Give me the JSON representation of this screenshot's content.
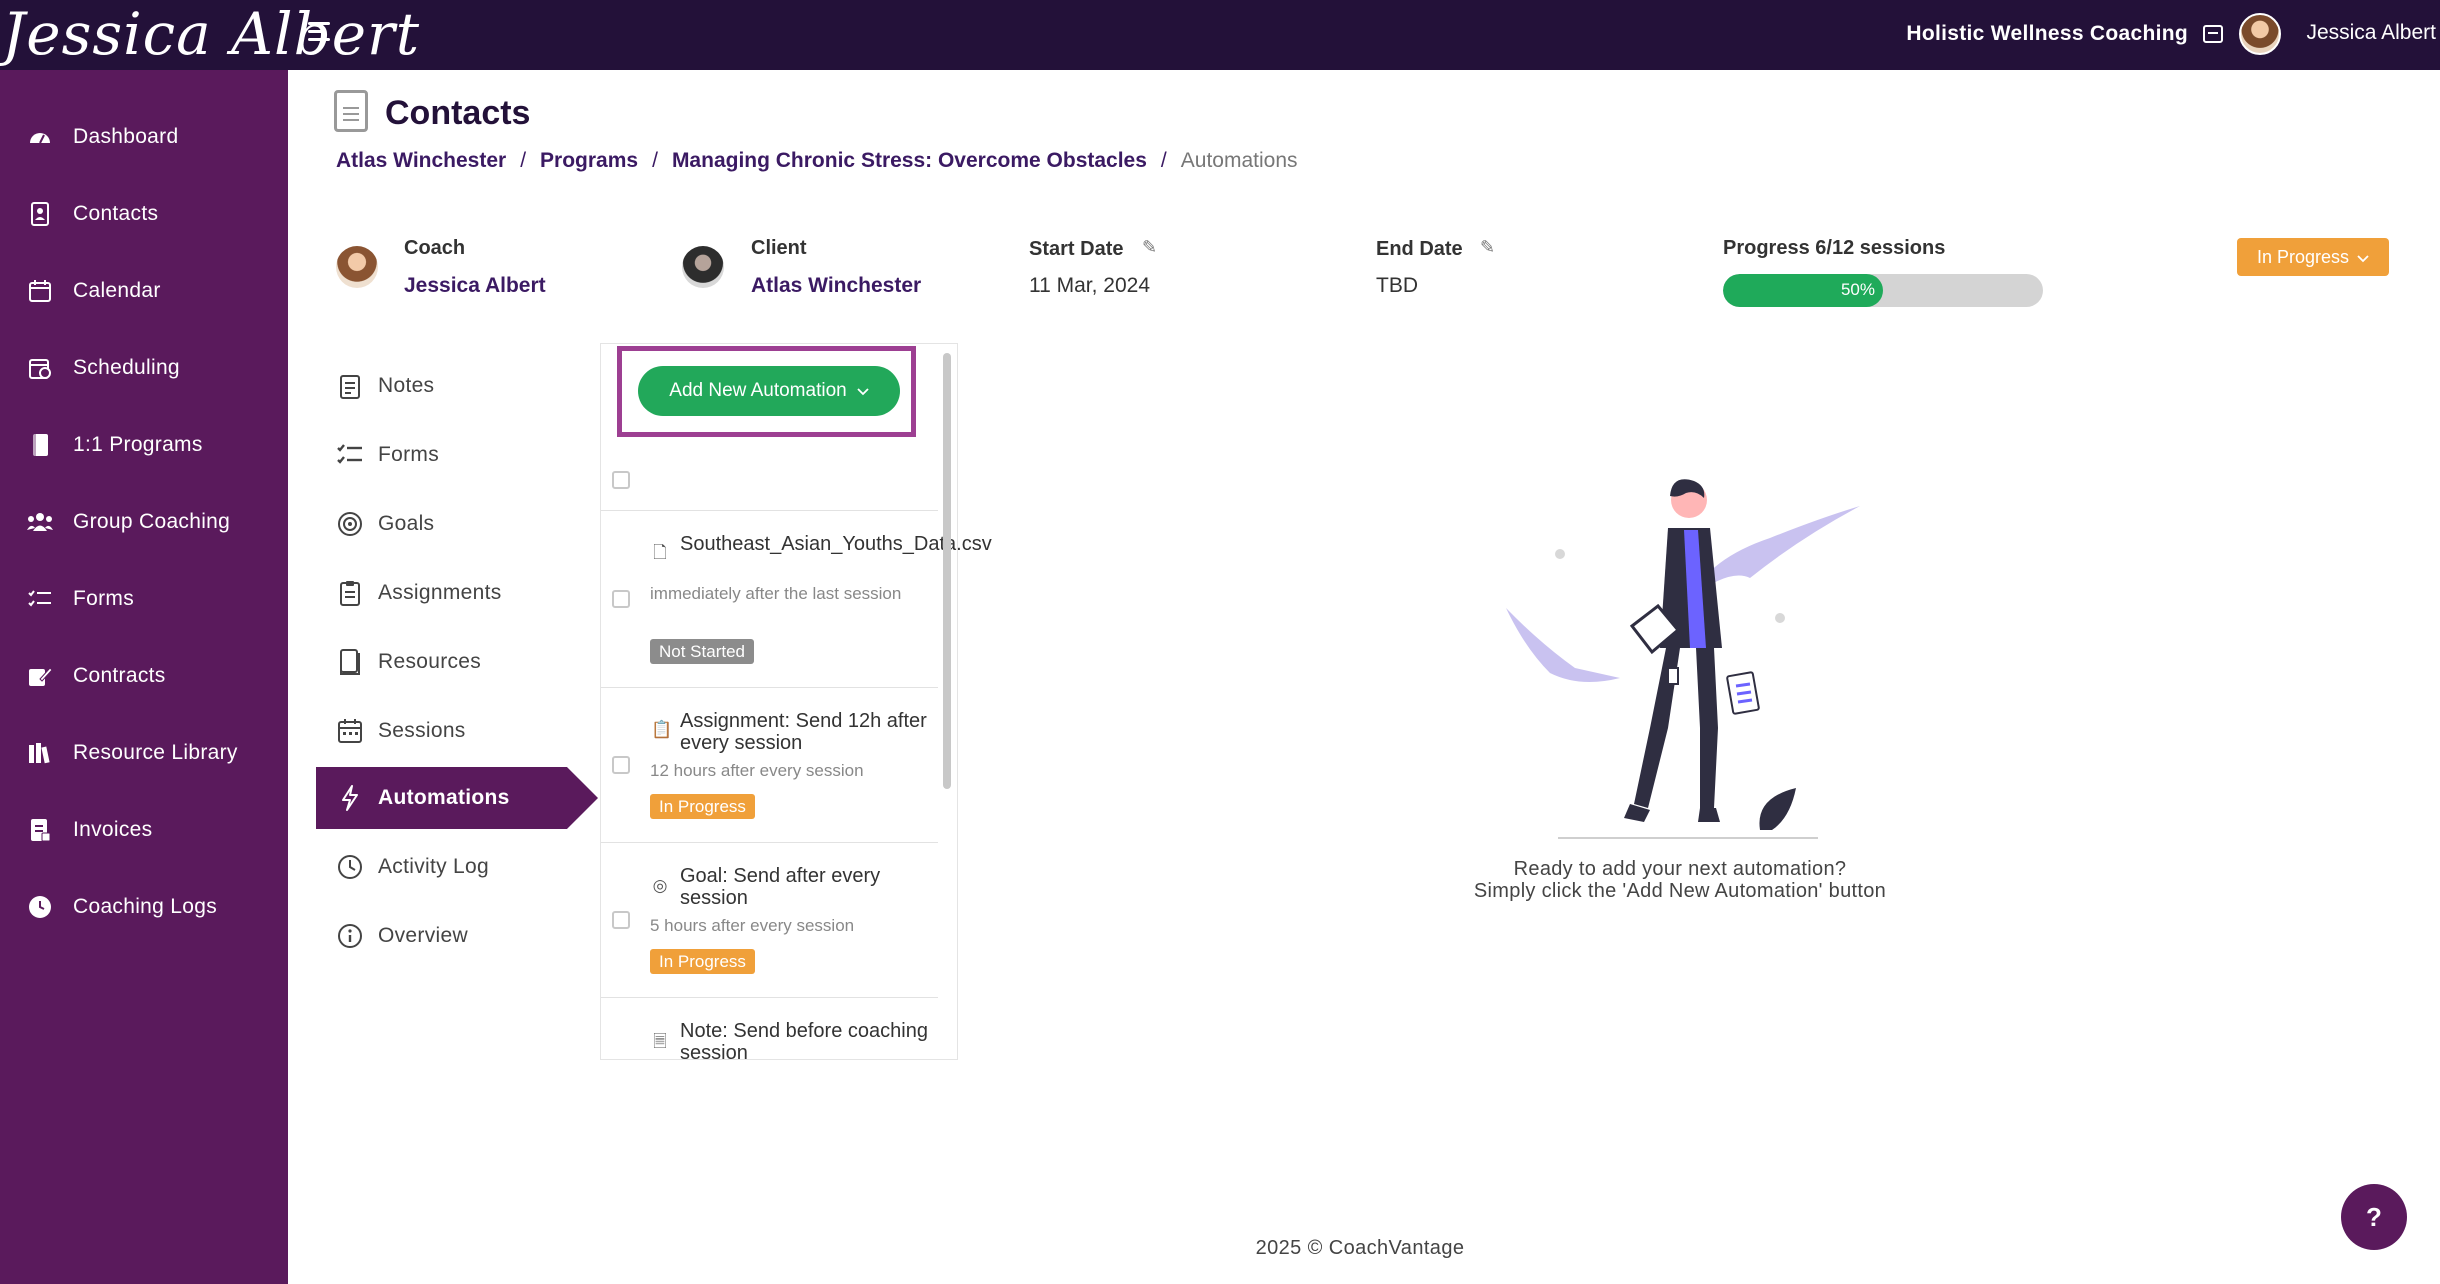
{
  "topbar": {
    "logo_text": "Jessica Albert",
    "org_name": "Holistic Wellness Coaching",
    "user_name": "Jessica Albert"
  },
  "sidebar": {
    "items": [
      {
        "label": "Dashboard",
        "icon": "dashboard-gauge-icon"
      },
      {
        "label": "Contacts",
        "icon": "contacts-book-icon"
      },
      {
        "label": "Calendar",
        "icon": "calendar-icon"
      },
      {
        "label": "Scheduling",
        "icon": "scheduling-calendar-icon"
      },
      {
        "label": "1:1 Programs",
        "icon": "book-icon"
      },
      {
        "label": "Group Coaching",
        "icon": "group-users-icon"
      },
      {
        "label": "Forms",
        "icon": "checklist-icon"
      },
      {
        "label": "Contracts",
        "icon": "signature-pen-icon"
      },
      {
        "label": "Resource Library",
        "icon": "library-icon"
      },
      {
        "label": "Invoices",
        "icon": "invoice-icon"
      },
      {
        "label": "Coaching Logs",
        "icon": "clock-icon"
      }
    ]
  },
  "page": {
    "title": "Contacts",
    "breadcrumb": {
      "contact": "Atlas Winchester",
      "programs": "Programs",
      "program": "Managing Chronic Stress: Overcome Obstacles",
      "current": "Automations",
      "sep": "/"
    }
  },
  "info": {
    "coach_label": "Coach",
    "coach_name": "Jessica Albert",
    "client_label": "Client",
    "client_name": "Atlas Winchester",
    "start_label": "Start Date",
    "start_value": "11 Mar, 2024",
    "end_label": "End Date",
    "end_value": "TBD",
    "progress_label": "Progress 6/12 sessions",
    "progress_percent": 50,
    "progress_text": "50%",
    "status": "In Progress"
  },
  "subnav": {
    "items": [
      {
        "label": "Notes",
        "icon": "notes-icon"
      },
      {
        "label": "Forms",
        "icon": "checklist-icon"
      },
      {
        "label": "Goals",
        "icon": "target-icon"
      },
      {
        "label": "Assignments",
        "icon": "clipboard-icon"
      },
      {
        "label": "Resources",
        "icon": "resources-book-icon"
      },
      {
        "label": "Sessions",
        "icon": "calendar-icon"
      },
      {
        "label": "Automations",
        "icon": "lightning-bolt-icon",
        "active": true
      },
      {
        "label": "Activity Log",
        "icon": "history-clock-icon"
      },
      {
        "label": "Overview",
        "icon": "info-circle-icon"
      }
    ]
  },
  "automations": {
    "add_button": "Add New Automation",
    "items": [
      {
        "title": "Southeast_Asian_Youths_Data.csv",
        "subtitle": "immediately after the last session",
        "status": "Not Started",
        "icon": "file-icon"
      },
      {
        "title": "Assignment: Send 12h after every session",
        "subtitle": "12 hours after every session",
        "status": "In Progress",
        "icon": "clipboard-icon"
      },
      {
        "title": "Goal: Send after every session",
        "subtitle": "5 hours after every session",
        "status": "In Progress",
        "icon": "target-icon"
      },
      {
        "title": "Note: Send before coaching session",
        "subtitle": "",
        "status": "",
        "icon": "notes-icon"
      }
    ]
  },
  "empty_state": {
    "line1": "Ready to add your next automation?",
    "line2": "Simply click the 'Add New Automation' button"
  },
  "footer": {
    "text": "2025 © CoachVantage"
  },
  "help": {
    "label": "?"
  },
  "colors": {
    "topbar": "#231139",
    "sidebar": "#5a1a5c",
    "accent_green": "#22a85a",
    "status_orange": "#f0a03a",
    "highlight": "#9d3f92"
  }
}
